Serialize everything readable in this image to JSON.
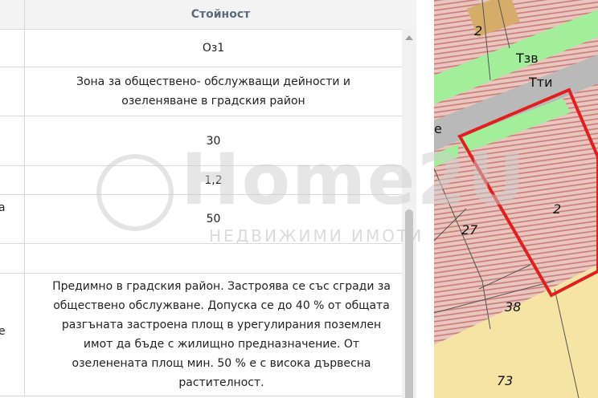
{
  "table": {
    "header": {
      "value_col": "Стойност"
    },
    "rows": [
      {
        "label": "",
        "value": "Оз1"
      },
      {
        "label": "",
        "value": "Зона за обществено- обслужващи дейности и озеленяване в градския район"
      },
      {
        "label": "",
        "value": "30"
      },
      {
        "label": "",
        "value": "1,2"
      },
      {
        "label": "а",
        "value": "50"
      },
      {
        "label": "",
        "value": ""
      },
      {
        "label": "е",
        "value": "Предимно в градския район. Застроява се със сгради за обществено обслужване. Допуска се до 40 % от общата разгъната застроена площ в урегулирания поземлен имот да бъде с жилищно предназначение. От озеленената площ мин. 50 % е с висока дървесна растителност."
      }
    ]
  },
  "map": {
    "labels": {
      "lot_top": "2",
      "tzv": "Тзв",
      "tti": "Тти",
      "road_e": "е",
      "lot_main": "2",
      "lot_27": "27",
      "lot_38": "38",
      "lot_73": "73"
    },
    "colors": {
      "hatch_bg": "#e9c6c0",
      "hatch_line": "#c97b73",
      "green_strip": "#a3ee9a",
      "road_gray": "#b9b9b9",
      "yellow_lot": "#f6e4a4",
      "tan_lot": "#d5ac6a",
      "outline_red": "#e02020"
    }
  },
  "watermark": {
    "title": "Home2U",
    "subtitle": "НЕДВИЖИМИ ИМОТИ"
  }
}
